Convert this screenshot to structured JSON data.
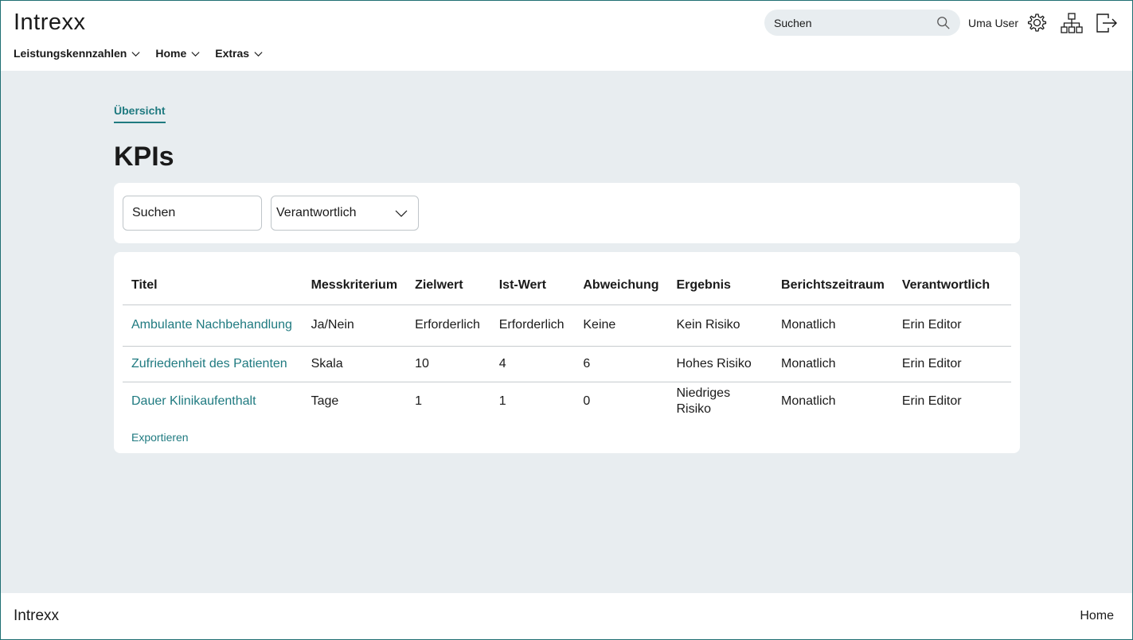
{
  "header": {
    "logo": "Intrexx",
    "search_placeholder": "Suchen",
    "user_name": "Uma User",
    "nav": [
      {
        "label": "Leistungskennzahlen"
      },
      {
        "label": "Home"
      },
      {
        "label": "Extras"
      }
    ],
    "icons": [
      "search-icon",
      "gear-icon",
      "sitemap-icon",
      "logout-icon"
    ]
  },
  "main": {
    "tab": "Übersicht",
    "title": "KPIs",
    "filters": {
      "search_placeholder": "Suchen",
      "responsible_select": "Verantwortlich"
    },
    "table": {
      "headers": [
        "Titel",
        "Messkriterium",
        "Zielwert",
        "Ist-Wert",
        "Abweichung",
        "Ergebnis",
        "Berichtszeitraum",
        "Verantwortlich"
      ],
      "rows": [
        [
          "Ambulante Nachbehandlung",
          "Ja/Nein",
          "Erforderlich",
          "Erforderlich",
          "Keine",
          "Kein Risiko",
          "Monatlich",
          "Erin Editor"
        ],
        [
          "Zufriedenheit des Patienten",
          "Skala",
          "10",
          "4",
          "6",
          "Hohes Risiko",
          "Monatlich",
          "Erin Editor"
        ],
        [
          "Dauer Klinikaufenthalt",
          "Tage",
          "1",
          "1",
          "0",
          "Niedriges Risiko",
          "Monatlich",
          "Erin Editor"
        ]
      ]
    },
    "export_label": "Exportieren"
  },
  "footer": {
    "logo": "Intrexx",
    "home": "Home"
  },
  "colors": {
    "accent": "#1f7a80",
    "background": "#e8edf0",
    "card": "#ffffff"
  }
}
